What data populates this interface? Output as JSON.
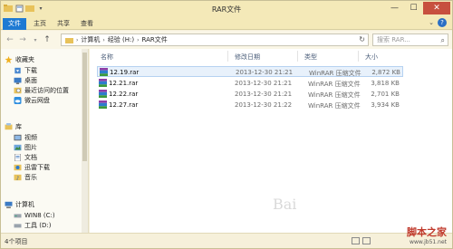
{
  "window": {
    "title": "RAR文件",
    "controls": {
      "minimize": "—",
      "maximize": "☐",
      "close": "✕"
    }
  },
  "ribbon": {
    "tabs": [
      {
        "label": "文件",
        "active": true
      },
      {
        "label": "主页",
        "active": false
      },
      {
        "label": "共享",
        "active": false
      },
      {
        "label": "查看",
        "active": false
      }
    ],
    "help": "?"
  },
  "address": {
    "segments": [
      "计算机",
      "经验 (H:)",
      "RAR文件"
    ],
    "search_placeholder": "搜索 RAR..."
  },
  "nav": {
    "favorites": {
      "label": "收藏夹",
      "items": [
        "下载",
        "桌面",
        "最近访问的位置",
        "微云网盘"
      ]
    },
    "libraries": {
      "label": "库",
      "items": [
        "视频",
        "图片",
        "文档",
        "迅雷下载",
        "音乐"
      ]
    },
    "computer": {
      "label": "计算机",
      "items": [
        "WIN8 (C:)",
        "工具 (D:)"
      ]
    }
  },
  "list": {
    "columns": {
      "name": "名称",
      "date": "修改日期",
      "type": "类型",
      "size": "大小"
    },
    "files": [
      {
        "name": "12.19.rar",
        "date": "2013-12-30 21:21",
        "type": "WinRAR 压缩文件",
        "size": "2,872 KB",
        "selected": true
      },
      {
        "name": "12.21.rar",
        "date": "2013-12-30 21:21",
        "type": "WinRAR 压缩文件",
        "size": "3,818 KB",
        "selected": false
      },
      {
        "name": "12.22.rar",
        "date": "2013-12-30 21:21",
        "type": "WinRAR 压缩文件",
        "size": "2,701 KB",
        "selected": false
      },
      {
        "name": "12.27.rar",
        "date": "2013-12-30 21:22",
        "type": "WinRAR 压缩文件",
        "size": "3,934 KB",
        "selected": false
      }
    ]
  },
  "status": {
    "count": "4个项目"
  },
  "watermark": {
    "brand": "脚本之家",
    "site": "www.jb51.net",
    "baidu": "Bai"
  },
  "colors": {
    "accent": "#1e7ad3",
    "close": "#c7503f",
    "folder": "#e8c25a"
  }
}
